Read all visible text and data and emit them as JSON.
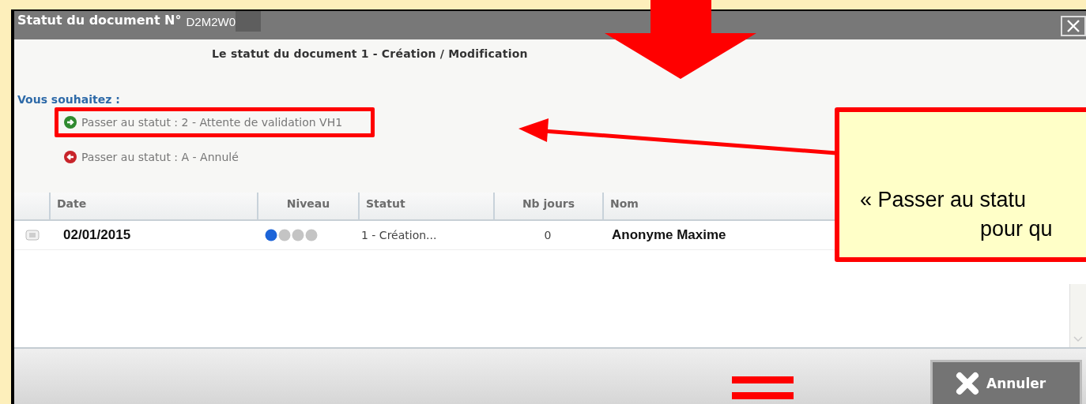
{
  "window": {
    "title": "Statut du document N°",
    "doc_number": "D2M2W0"
  },
  "message": "Le statut du document 1 - Création / Modification",
  "prompt": "Vous souhaitez :",
  "options": [
    {
      "kind": "forward",
      "label": "Passer au statut : 2 - Attente de validation VH1",
      "highlighted": true
    },
    {
      "kind": "back",
      "label": "Passer au statut : A - Annulé",
      "highlighted": false
    }
  ],
  "table": {
    "columns": [
      "Date",
      "Niveau",
      "Statut",
      "Nb jours",
      "Nom"
    ],
    "rows": [
      {
        "date": "02/01/2015",
        "stars": 1,
        "statut": "1 - Création...",
        "nb_jours": "0",
        "nom": "Anonyme Maxime"
      }
    ]
  },
  "buttons": [
    {
      "kind": "cancel",
      "label": "Annuler"
    }
  ],
  "callout": {
    "lines": [
      "« Passer au statu",
      "pour qu"
    ]
  }
}
